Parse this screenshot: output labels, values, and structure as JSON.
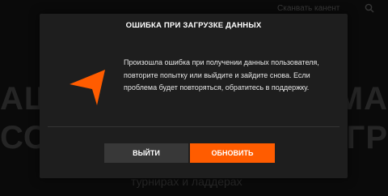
{
  "background": {
    "search_placeholder": "Сканвать канент",
    "hero_left": "АШ\nСО",
    "hero_right": "РМА\nГР",
    "subtitle": "турнирах и ладдерах"
  },
  "dialog": {
    "title": "ОШИБКА ПРИ ЗАГРУЗКЕ ДАННЫХ",
    "icon": "orange-arrow-icon",
    "message": "Произошла ошибка при получении данных пользователя, повторите попытку или выйдите и зайдите снова. Если проблема будет повторяться, обратитесь в поддержку.",
    "exit_label": "ВЫЙТИ",
    "refresh_label": "ОБНОВИТЬ"
  },
  "colors": {
    "accent": "#ff5c00",
    "dialog_bg": "#1e1e1e",
    "secondary_button": "#383838"
  }
}
